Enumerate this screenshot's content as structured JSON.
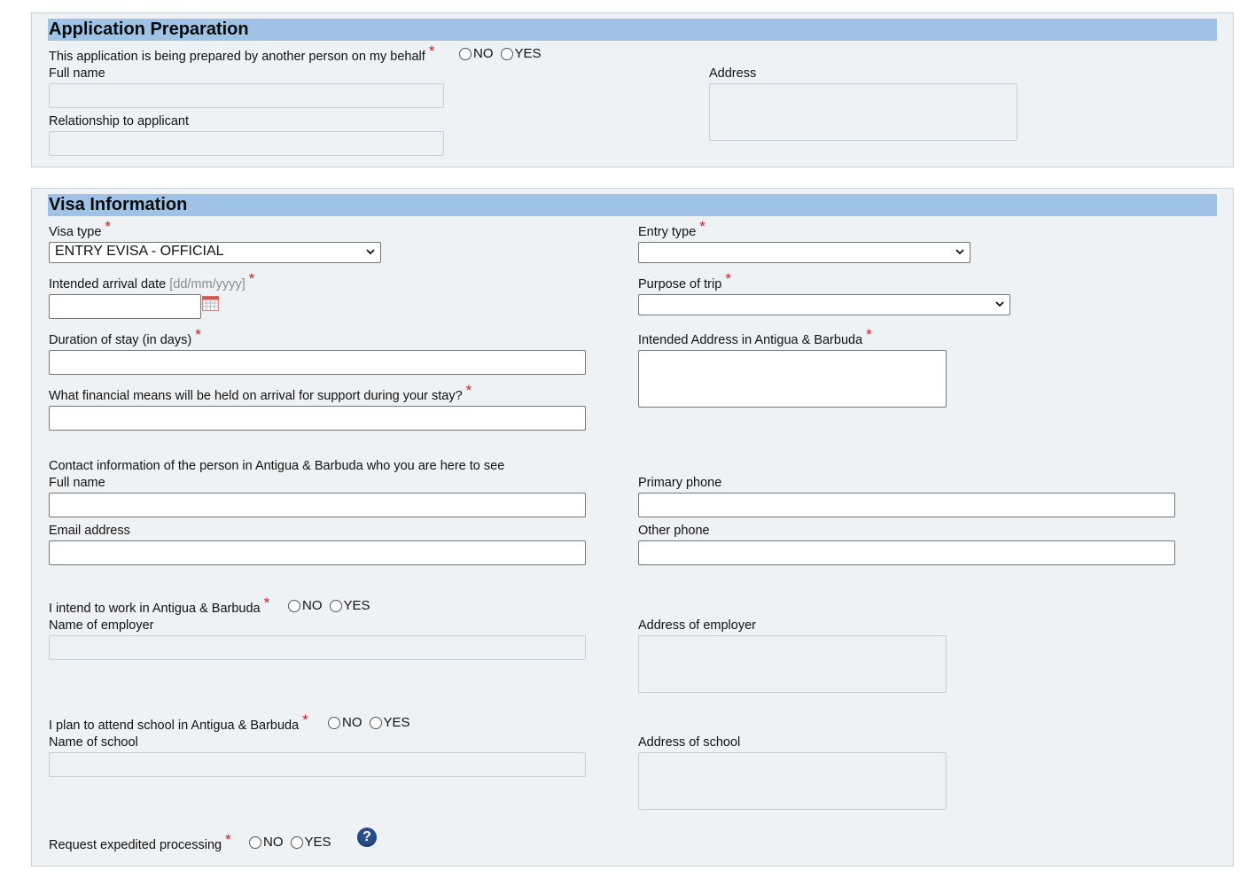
{
  "application_preparation": {
    "title": "Application Preparation",
    "prepared_by_other_label": "This application is being prepared by another person on my behalf",
    "full_name_label": "Full name",
    "relationship_label": "Relationship to applicant",
    "address_label": "Address"
  },
  "visa_information": {
    "title": "Visa Information",
    "visa_type_label": "Visa type",
    "visa_type_value": "ENTRY EVISA - OFFICIAL",
    "entry_type_label": "Entry type",
    "entry_type_value": "",
    "arrival_date_label": "Intended arrival date",
    "arrival_date_hint": "[dd/mm/yyyy]",
    "purpose_label": "Purpose of trip",
    "purpose_value": "",
    "duration_label": "Duration of stay (in days)",
    "intended_address_label": "Intended Address in Antigua & Barbuda",
    "financial_label": "What financial means will be held on arrival for support during your stay?",
    "contact_intro": "Contact information of the person in Antigua & Barbuda who you are here to see",
    "contact_full_name_label": "Full name",
    "primary_phone_label": "Primary phone",
    "email_label": "Email address",
    "other_phone_label": "Other phone",
    "work_label": "I intend to work in Antigua & Barbuda",
    "employer_name_label": "Name of employer",
    "employer_address_label": "Address of employer",
    "school_label": "I plan to attend school in Antigua & Barbuda",
    "school_name_label": "Name of school",
    "school_address_label": "Address of school",
    "expedited_label": "Request expedited processing",
    "help_symbol": "?"
  },
  "radio": {
    "no": "NO",
    "yes": "YES"
  },
  "required_marker": "*",
  "colors": {
    "section_header": "#9fc3e6",
    "section_bg": "#eff2f5",
    "required": "#d71920",
    "help_icon": "#2a4f8f"
  }
}
